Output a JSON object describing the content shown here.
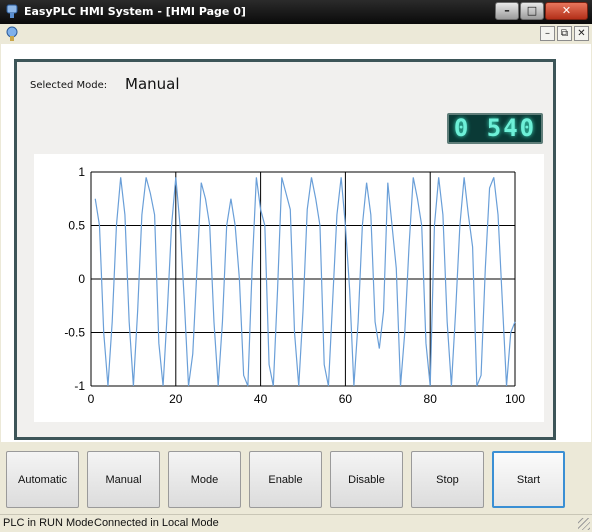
{
  "window": {
    "title": "EasyPLC HMI System - [HMI Page 0]",
    "minimize_glyph": "–",
    "maximize_glyph": "□",
    "close_glyph": "✕",
    "icon": "plc-app-icon"
  },
  "mdi_bar": {
    "doc_icon": "hmi-page-icon",
    "minimize_glyph": "–",
    "restore_glyph": "⧉",
    "close_glyph": "✕"
  },
  "panel": {
    "mode_caption": "Selected Mode:",
    "mode_value": "Manual",
    "counter_display": "0 540"
  },
  "chart_data": {
    "type": "line",
    "title": "",
    "xlabel": "",
    "ylabel": "",
    "xlim": [
      0,
      100
    ],
    "ylim": [
      -1,
      1
    ],
    "x_ticks": [
      "0",
      "20",
      "40",
      "60",
      "80",
      "100"
    ],
    "y_ticks": [
      "1",
      "0.5",
      "0",
      "-0.5",
      "-1"
    ],
    "grid": true,
    "series": [
      {
        "color": "#6a9fd8",
        "x": [
          1,
          2,
          3,
          4,
          5,
          6,
          7,
          8,
          9,
          10,
          11,
          12,
          13,
          14,
          15,
          16,
          17,
          18,
          19,
          20,
          21,
          22,
          23,
          24,
          25,
          26,
          27,
          28,
          29,
          30,
          31,
          32,
          33,
          34,
          35,
          36,
          37,
          38,
          39,
          40,
          41,
          42,
          43,
          44,
          45,
          46,
          47,
          48,
          49,
          50,
          51,
          52,
          53,
          54,
          55,
          56,
          57,
          58,
          59,
          60,
          61,
          62,
          63,
          64,
          65,
          66,
          67,
          68,
          69,
          70,
          71,
          72,
          73,
          74,
          75,
          76,
          77,
          78,
          79,
          80,
          81,
          82,
          83,
          84,
          85,
          86,
          87,
          88,
          89,
          90,
          91,
          92,
          93,
          94,
          95,
          96,
          97,
          98,
          99,
          100
        ],
        "y": [
          0.75,
          0.5,
          -0.5,
          -1,
          -0.4,
          0.5,
          0.95,
          0.6,
          -0.4,
          -1,
          -0.3,
          0.6,
          0.95,
          0.8,
          0.6,
          -0.6,
          -1,
          -0.3,
          0.5,
          0.95,
          0.5,
          -0.2,
          -1,
          -0.7,
          0.1,
          0.9,
          0.75,
          0.5,
          -0.4,
          -1,
          -0.4,
          0.5,
          0.75,
          0.5,
          0.0,
          -0.9,
          -1,
          0.1,
          0.95,
          0.65,
          0.5,
          -0.8,
          -1,
          -0.1,
          0.95,
          0.8,
          0.65,
          -0.5,
          -1,
          -0.3,
          0.65,
          0.95,
          0.75,
          0.5,
          -0.8,
          -1,
          -0.2,
          0.6,
          0.95,
          0.5,
          -0.1,
          -1,
          -0.4,
          0.5,
          0.9,
          0.6,
          -0.4,
          -0.65,
          -0.3,
          0.9,
          0.5,
          0.1,
          -1,
          -0.5,
          0.3,
          0.95,
          0.75,
          0.5,
          -0.6,
          -1,
          0.5,
          0.95,
          0.6,
          -0.4,
          -1,
          -0.3,
          0.5,
          0.95,
          0.6,
          0.3,
          -1,
          -0.9,
          0.1,
          0.85,
          0.95,
          0.6,
          -0.2,
          -1,
          -0.5,
          -0.4
        ]
      }
    ]
  },
  "buttons": [
    {
      "label": "Automatic",
      "name": "automatic-button",
      "active": false
    },
    {
      "label": "Manual",
      "name": "manual-button",
      "active": false
    },
    {
      "label": "Mode",
      "name": "mode-button",
      "active": false
    },
    {
      "label": "Enable",
      "name": "enable-button",
      "active": false
    },
    {
      "label": "Disable",
      "name": "disable-button",
      "active": false
    },
    {
      "label": "Stop",
      "name": "stop-button",
      "active": false
    },
    {
      "label": "Start",
      "name": "start-button",
      "active": true
    }
  ],
  "status": {
    "plc_state": "PLC in RUN Mode",
    "connection": "Connected in Local Mode"
  }
}
